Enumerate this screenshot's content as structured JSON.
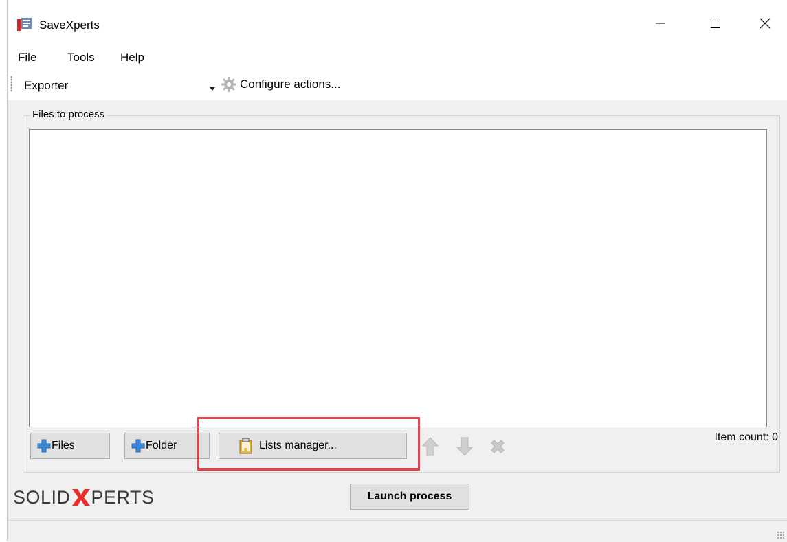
{
  "window": {
    "title": "SaveXperts"
  },
  "menu": {
    "items": [
      "File",
      "Tools",
      "Help"
    ]
  },
  "toolbar": {
    "selected_preset": "Exporter",
    "configure_label": "Configure actions..."
  },
  "files_group": {
    "legend": "Files to process",
    "add_files_label": "Files",
    "add_folder_label": "Folder",
    "lists_manager_label": "Lists manager...",
    "item_count": "Item count: 0"
  },
  "branding": {
    "logo_left": "SOLID",
    "logo_right": "PERTS",
    "logo_accent_color": "#e8302b"
  },
  "actions": {
    "launch_label": "Launch process"
  },
  "highlight": {
    "color": "#e8404a"
  }
}
